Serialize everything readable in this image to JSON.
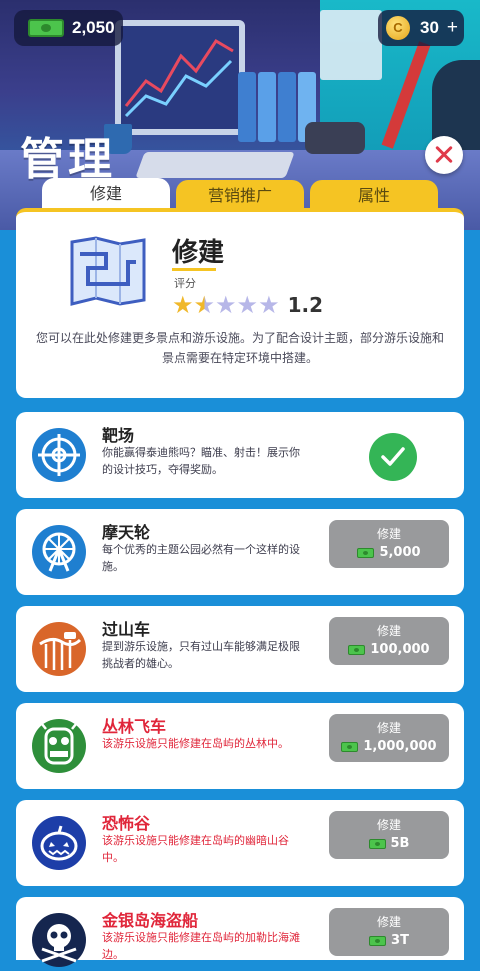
{
  "currency": {
    "cash": "2,050",
    "coins": "30",
    "coin_plus": "+",
    "coin_symbol": "C"
  },
  "page": {
    "title": "管理"
  },
  "tabs": [
    {
      "label": "修建",
      "active": true
    },
    {
      "label": "营销推广",
      "active": false
    },
    {
      "label": "属性",
      "active": false
    }
  ],
  "info": {
    "title": "修建",
    "rating_label": "评分",
    "rating_value": "1.2",
    "rating_stars": 1.2,
    "rating_max": 5,
    "description": "您可以在此处修建更多景点和游乐设施。为了配合设计主题，部分游乐设施和景点需要在特定环境中搭建。"
  },
  "attractions": [
    {
      "name": "靶场",
      "desc": "你能赢得泰迪熊吗？瞄准、射击！展示你的设计技巧，夺得奖励。",
      "status": "built",
      "icon": "target-icon"
    },
    {
      "name": "摩天轮",
      "desc": "每个优秀的主题公园必然有一个这样的设施。",
      "status": "available",
      "button": "修建",
      "cost": "5,000",
      "icon": "ferris-wheel-icon"
    },
    {
      "name": "过山车",
      "desc": "提到游乐设施，只有过山车能够满足极限挑战者的雄心。",
      "status": "available",
      "button": "修建",
      "cost": "100,000",
      "icon": "roller-coaster-icon"
    },
    {
      "name": "丛林飞车",
      "desc": "该游乐设施只能修建在岛屿的丛林中。",
      "status": "locked",
      "button": "修建",
      "cost": "1,000,000",
      "icon": "jungle-mask-icon"
    },
    {
      "name": "恐怖谷",
      "desc": "该游乐设施只能修建在岛屿的幽暗山谷中。",
      "status": "locked",
      "button": "修建",
      "cost": "5B",
      "icon": "pumpkin-icon"
    },
    {
      "name": "金银岛海盗船",
      "desc": "该游乐设施只能修建在岛屿的加勒比海滩边。",
      "status": "locked",
      "button": "修建",
      "cost": "3T",
      "icon": "skull-crossbones-icon"
    }
  ],
  "colors": {
    "accent_yellow": "#f5c423",
    "built_green": "#34b556",
    "locked_red": "#e0263a",
    "button_gray": "#999a9c"
  }
}
